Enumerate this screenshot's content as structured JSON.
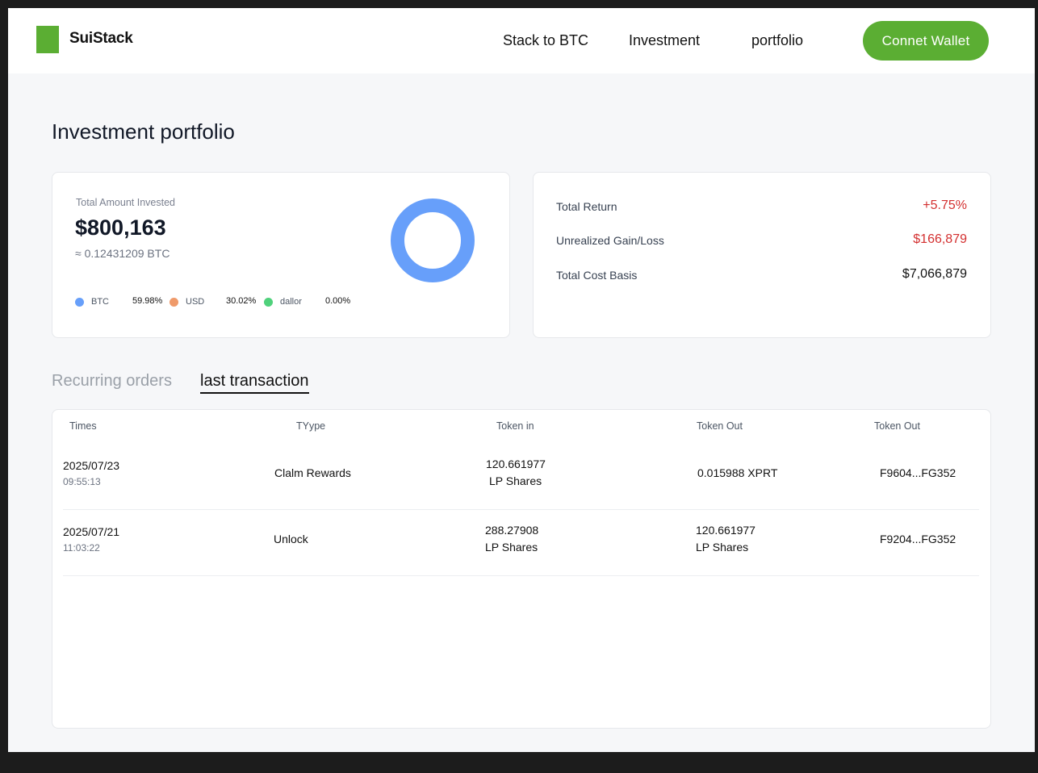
{
  "brand": {
    "name": "SuiStack",
    "color": "#5bae33"
  },
  "nav": {
    "items": [
      "Stack to BTC",
      "Investment",
      "portfolio"
    ],
    "connect_label": "Connet Wallet"
  },
  "page": {
    "title": "Investment portfolio"
  },
  "summary": {
    "label": "Total Amount Invested",
    "amount": "$800,163",
    "btc": "≈ 0.12431209 BTC",
    "legend": [
      {
        "name": "BTC",
        "pct": "59.98%",
        "color": "#679ffa"
      },
      {
        "name": "USD",
        "pct": "30.02%",
        "color": "#ef9a6a"
      },
      {
        "name": "dallor",
        "pct": "0.00%",
        "color": "#4fd17b"
      }
    ],
    "donut_color": "#679ffa"
  },
  "stats": [
    {
      "label": "Total Return",
      "value": "+5.75%",
      "color": "#d32f2f"
    },
    {
      "label": "Unrealized Gain/Loss",
      "value": "$166,879",
      "color": "#d32f2f"
    },
    {
      "label": "Total Cost Basis",
      "value": "$7,066,879",
      "color": "#111111"
    }
  ],
  "tabs": [
    {
      "label": "Recurring orders",
      "active": false
    },
    {
      "label": "last transaction",
      "active": true
    }
  ],
  "table": {
    "headers": [
      "Times",
      "TYype",
      "Token in",
      "Token Out",
      "Token Out"
    ],
    "rows": [
      {
        "date": "2025/07/23",
        "time": "09:55:13",
        "type": "Clalm Rewards",
        "token_in": [
          "120.661977",
          "LP Shares"
        ],
        "token_out": [
          "0.015988 XPRT"
        ],
        "hash": "F9604...FG352"
      },
      {
        "date": "2025/07/21",
        "time": "11:03:22",
        "type": "Unlock",
        "token_in": [
          "288.27908",
          "LP Shares"
        ],
        "token_out": [
          "120.661977",
          "LP Shares"
        ],
        "hash": "F9204...FG352"
      }
    ]
  }
}
